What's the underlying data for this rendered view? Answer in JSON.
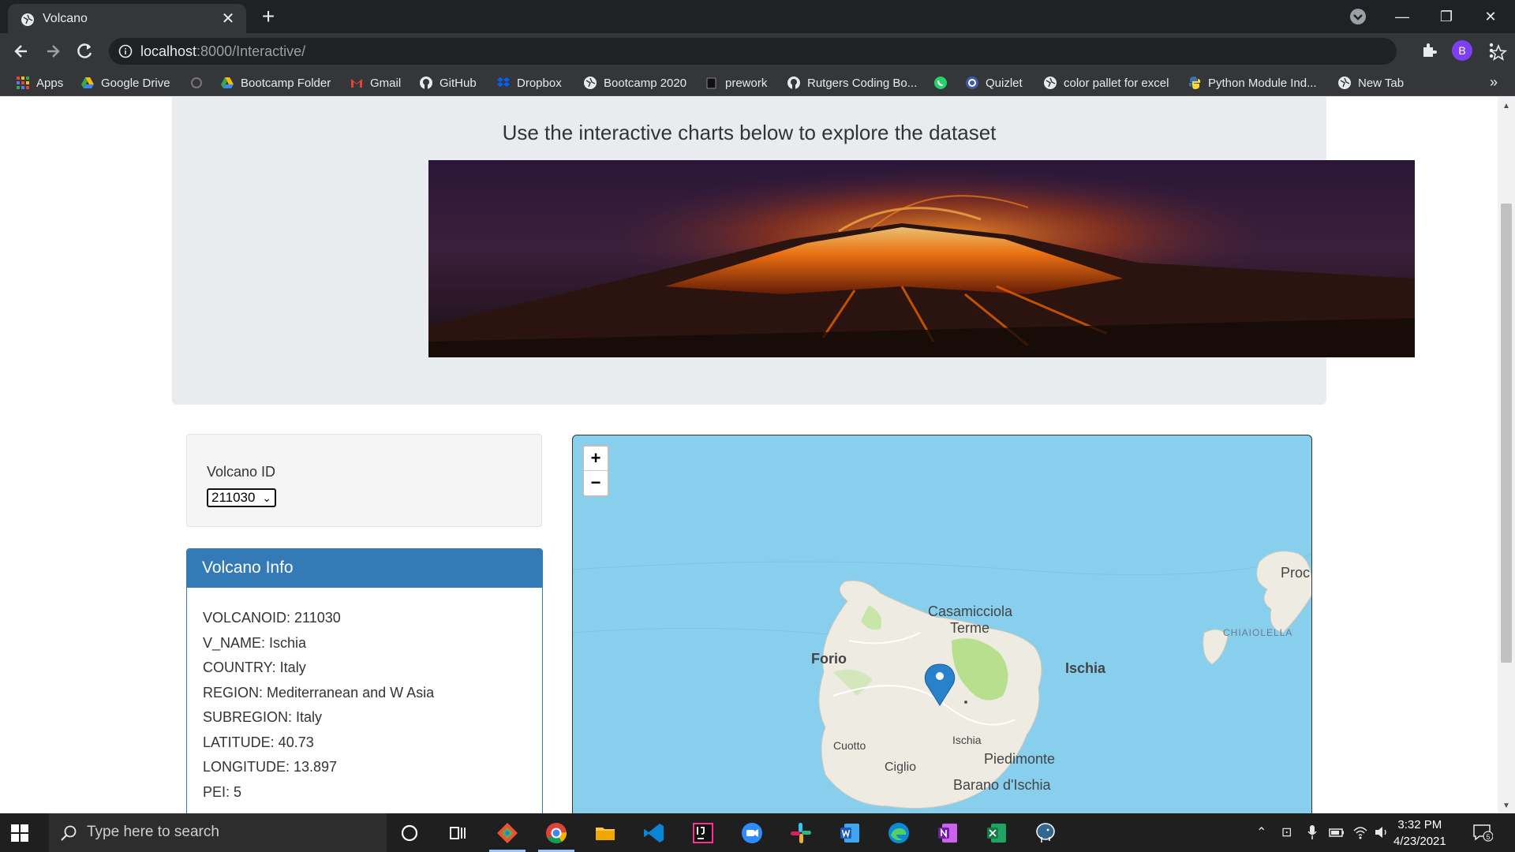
{
  "browser": {
    "tab_title": "Volcano",
    "url_host": "localhost",
    "url_rest": ":8000/Interactive/",
    "profile_initial": "B",
    "bookmarks": [
      "Apps",
      "Google Drive",
      "Bootcamp Folder",
      "Gmail",
      "GitHub",
      "Dropbox",
      "Bootcamp 2020",
      "prework",
      "Rutgers Coding Bo...",
      "Quizlet",
      "color pallet for excel",
      "Python Module Ind...",
      "New Tab"
    ],
    "more_bookmarks": "»"
  },
  "page": {
    "subtitle": "Use the interactive charts below to explore the dataset",
    "select_label": "Volcano ID",
    "selected_id": "211030",
    "info_title": "Volcano Info",
    "info_lines": [
      "VOLCANOID: 211030",
      "V_NAME: Ischia",
      "COUNTRY: Italy",
      "REGION: Mediterranean and W Asia",
      "SUBREGION: Italy",
      "LATITUDE: 40.73",
      "LONGITUDE: 13.897",
      "PEI: 5"
    ]
  },
  "map": {
    "zoom_in": "+",
    "zoom_out": "−",
    "labels": [
      "Casamicciola",
      "Terme",
      "Forio",
      "Ischia",
      "Cuotto",
      "Ischia",
      "Piedimonte",
      "Ciglio",
      "Barano d'Ischia",
      "Proc",
      "CHIAIOLELLA"
    ]
  },
  "taskbar": {
    "search_placeholder": "Type here to search",
    "time": "3:32 PM",
    "date": "4/23/2021",
    "notification_count": "5"
  },
  "colors": {
    "primary": "#337ab7",
    "water": "#88cfee",
    "land": "#eeebe3",
    "chrome_dark": "#202124",
    "chrome_mid": "#35363a"
  }
}
